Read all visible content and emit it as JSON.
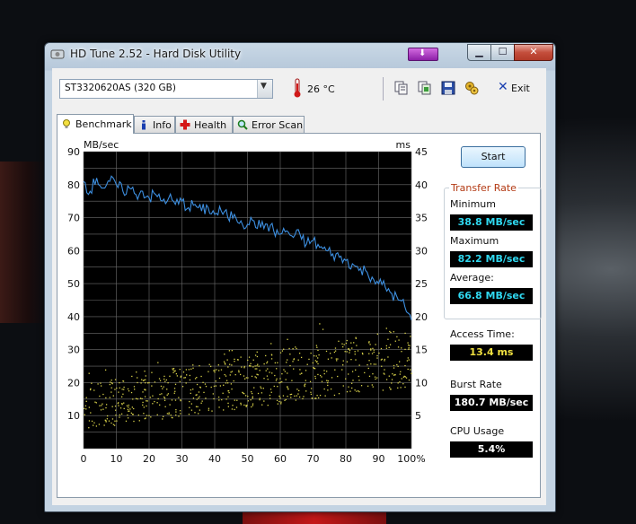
{
  "window": {
    "title": "HD Tune 2.52 - Hard Disk Utility"
  },
  "toolbar": {
    "drive": "ST3320620AS (320 GB)",
    "temperature": "26 °C",
    "exit_label": "Exit"
  },
  "tabs": [
    {
      "label": "Benchmark",
      "active": true
    },
    {
      "label": "Info"
    },
    {
      "label": "Health"
    },
    {
      "label": "Error Scan"
    }
  ],
  "benchmark": {
    "start_label": "Start",
    "transfer_rate_title": "Transfer Rate",
    "minimum_label": "Minimum",
    "minimum_value": "38.8 MB/sec",
    "maximum_label": "Maximum",
    "maximum_value": "82.2 MB/sec",
    "average_label": "Average:",
    "average_value": "66.8 MB/sec",
    "access_label": "Access Time:",
    "access_value": "13.4 ms",
    "burst_label": "Burst Rate",
    "burst_value": "180.7 MB/sec",
    "cpu_label": "CPU Usage",
    "cpu_value": "5.4%"
  },
  "colors": {
    "plot_bg": "#000000",
    "grid": "#6e6e6e",
    "transfer_line": "#3d8fe0",
    "access_dots": "#d9d24a",
    "value_cyan": "#2fd8f0",
    "value_yellow": "#f0e040",
    "value_white": "#ffffff",
    "group_title": "#b33a14"
  },
  "chart_data": {
    "type": "line",
    "left_axis_unit": "MB/sec",
    "right_axis_unit": "ms",
    "left_ticks": [
      "90",
      "80",
      "70",
      "60",
      "50",
      "40",
      "30",
      "20",
      "10"
    ],
    "right_ticks": [
      "45",
      "40",
      "35",
      "30",
      "25",
      "20",
      "15",
      "10",
      "5"
    ],
    "x_ticks": [
      "0",
      "10",
      "20",
      "30",
      "40",
      "50",
      "60",
      "70",
      "80",
      "90",
      "100%"
    ],
    "xlim": [
      0,
      100
    ],
    "ylim_left": [
      0,
      90
    ],
    "ylim_right": [
      0,
      45
    ],
    "grid": true,
    "series": [
      {
        "x": [
          0,
          2,
          4,
          6,
          8,
          10,
          12,
          14,
          16,
          18,
          20,
          22,
          24,
          26,
          28,
          30,
          32,
          34,
          36,
          38,
          40,
          42,
          44,
          46,
          48,
          50,
          52,
          54,
          56,
          58,
          60,
          62,
          64,
          66,
          68,
          70,
          72,
          74,
          76,
          78,
          80,
          82,
          84,
          86,
          88,
          90,
          92,
          94,
          96,
          98,
          100
        ],
        "y": [
          81,
          78,
          82,
          79,
          81,
          80,
          78,
          79,
          77,
          78,
          76,
          77,
          75,
          76,
          74,
          75,
          73,
          74,
          72,
          73,
          71,
          72,
          70,
          71,
          69,
          68,
          69,
          67,
          68,
          66,
          65,
          66,
          64,
          65,
          62,
          63,
          61,
          60,
          59,
          58,
          57,
          56,
          54,
          54,
          52,
          50,
          49,
          47,
          45,
          43,
          39
        ]
      }
    ],
    "access_time_ms_range": [
      3,
      20
    ]
  }
}
